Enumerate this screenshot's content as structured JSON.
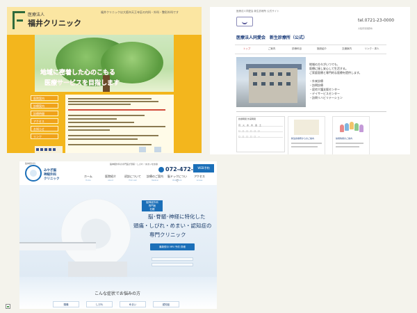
{
  "panel_a": {
    "logo_sub": "医療法人",
    "logo_name": "福井クリニック",
    "header_info": "福井クリニックは大阪市天王寺区の内科・外科・整形外科です",
    "slogan_line1": "地域に密着した心のこもる",
    "slogan_line2": "医療サービスを目指します",
    "sidebar_items": [
      "医院案内",
      "診療案内",
      "診療時間",
      "アクセス",
      "お知らせ",
      "リンク"
    ],
    "colors": {
      "accent": "#f3b61d",
      "slogan": "#f25d2a"
    }
  },
  "panel_b": {
    "breadcrumb": "医療法人同愛会 新生診療所 公式サイト",
    "org_name": "医療法人同愛会　新生診療所（公式）",
    "tel": "tel.0721-23-0000",
    "address": "大阪府羽曳野市",
    "nav": [
      "トップ",
      "ご案内",
      "診療科目",
      "施設紹介",
      "交通案内",
      "リンク・求人"
    ],
    "intro_lines": [
      "地域の方々がいつでも、",
      "医療に接し安心して生活する。",
      "ご家庭医療と専門的な医療を提供します。"
    ],
    "service_list": [
      "・外来診療",
      "・訪問診療",
      "・居宅介護支援センター",
      "・デイサービスセンター",
      "・訪問リハビリテーション"
    ],
    "schedule_title": "診療時間 外来時間",
    "schedule_rows": [
      "月火水木金土",
      "○○○○○○",
      "○○○○○－"
    ],
    "cards": [
      {
        "title": "お知らせ",
        "link": "新生診療所からのご案内"
      },
      {
        "title": "スタッフ",
        "link": "採用情報のご案内"
      }
    ],
    "colors": {
      "brand": "#1b3c7a"
    }
  },
  "panel_c": {
    "logo_top": "脳神経外科",
    "logo_name_line1": "みやぎ脳",
    "logo_name_line2": "神経外科",
    "logo_name_line3": "クリニック",
    "top_note": "脳神経外科の専門医が頭痛・しびれ・めまいを診療",
    "phone": "072-472-0213",
    "book_button": "WEB予約",
    "nav": [
      {
        "label": "ホーム",
        "sub": "Home"
      },
      {
        "label": "医院紹介",
        "sub": "About"
      },
      {
        "label": "初診について",
        "sub": "First visit"
      },
      {
        "label": "診療のご案内",
        "sub": "Medical"
      },
      {
        "label": "脳ドックについて",
        "sub": "Brain dock"
      },
      {
        "label": "アクセス",
        "sub": "Access"
      }
    ],
    "badge_line1": "脳神経外科",
    "badge_line2": "専門医",
    "badge_line3": "在籍",
    "headline_line1": "脳･脊髄･神経に特化した",
    "headline_line2": "頭痛・しびれ・めまい・認知症の",
    "headline_line3": "専門クリニック",
    "hero_button": "最新鋭の MRI 予約 詳細",
    "symptom_title": "こんな症状でお悩みの方",
    "symptoms": [
      "頭痛",
      "しびれ",
      "めまい",
      "認知症"
    ],
    "colors": {
      "brand": "#1b6fb8",
      "navy": "#1b3c6a"
    }
  },
  "broken_image_icon": "broken-image-icon"
}
